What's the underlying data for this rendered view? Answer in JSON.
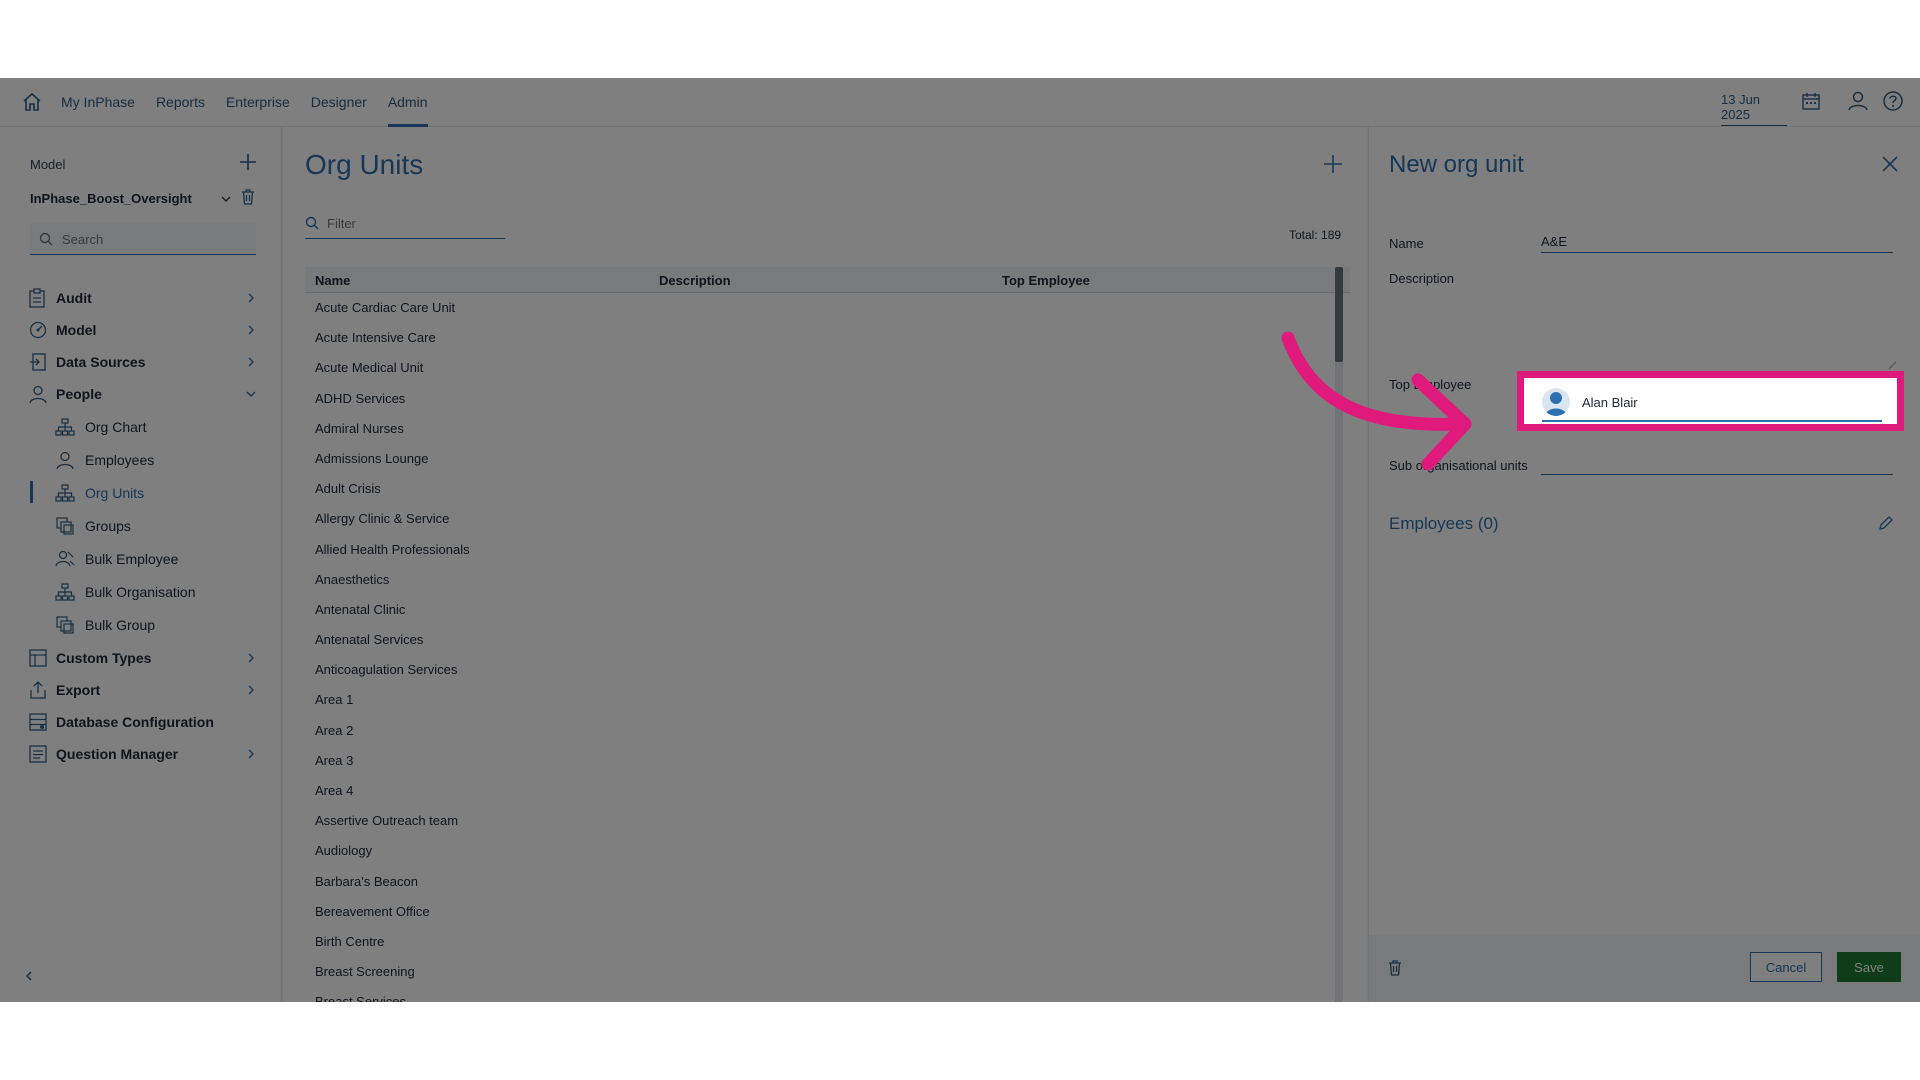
{
  "nav": {
    "items": [
      "My InPhase",
      "Reports",
      "Enterprise",
      "Designer",
      "Admin"
    ],
    "active": "Admin",
    "date": "13 Jun 2025"
  },
  "sidebar": {
    "model_label": "Model",
    "model_value": "InPhase_Boost_Oversight",
    "search_placeholder": "Search",
    "items": [
      {
        "label": "Audit",
        "icon": "audit-icon"
      },
      {
        "label": "Model",
        "icon": "model-icon"
      },
      {
        "label": "Data Sources",
        "icon": "data-sources-icon"
      },
      {
        "label": "People",
        "icon": "person-icon"
      }
    ],
    "people_sub": [
      {
        "label": "Org Chart",
        "icon": "org-chart-icon"
      },
      {
        "label": "Employees",
        "icon": "person-icon"
      },
      {
        "label": "Org Units",
        "icon": "org-chart-icon"
      },
      {
        "label": "Groups",
        "icon": "groups-icon"
      },
      {
        "label": "Bulk Employee",
        "icon": "bulk-employee-icon"
      },
      {
        "label": "Bulk Organisation",
        "icon": "org-chart-icon"
      },
      {
        "label": "Bulk Group",
        "icon": "groups-icon"
      }
    ],
    "items_after": [
      {
        "label": "Custom Types",
        "icon": "custom-types-icon"
      },
      {
        "label": "Export",
        "icon": "export-icon"
      },
      {
        "label": "Database Configuration",
        "icon": "database-icon"
      },
      {
        "label": "Question Manager",
        "icon": "question-manager-icon"
      }
    ]
  },
  "main": {
    "title": "Org Units",
    "filter_placeholder": "Filter",
    "total": "Total: 189",
    "columns": [
      "Name",
      "Description",
      "Top Employee"
    ],
    "rows": [
      "Acute Cardiac Care Unit",
      "Acute Intensive Care",
      "Acute Medical Unit",
      "ADHD Services",
      "Admiral Nurses",
      "Admissions Lounge",
      "Adult Crisis",
      "Allergy Clinic & Service",
      "Allied Health Professionals",
      "Anaesthetics",
      "Antenatal Clinic",
      "Antenatal Services",
      "Anticoagulation Services",
      "Area 1",
      "Area 2",
      "Area 3",
      "Area 4",
      "Assertive Outreach team",
      "Audiology",
      "Barbara's Beacon",
      "Bereavement Office",
      "Birth Centre",
      "Breast Screening",
      "Breast Services"
    ]
  },
  "panel": {
    "title": "New org unit",
    "name_label": "Name",
    "name_value": "A&E",
    "description_label": "Description",
    "top_employee_label": "Top Employee",
    "top_employee_value": "Alan Blair",
    "sub_org_label": "Sub organisational units",
    "employees_heading": "Employees (0)",
    "cancel": "Cancel",
    "save": "Save"
  },
  "colors": {
    "accent": "#2e6fb0",
    "highlight": "#e0197d",
    "save": "#1e7b34"
  }
}
